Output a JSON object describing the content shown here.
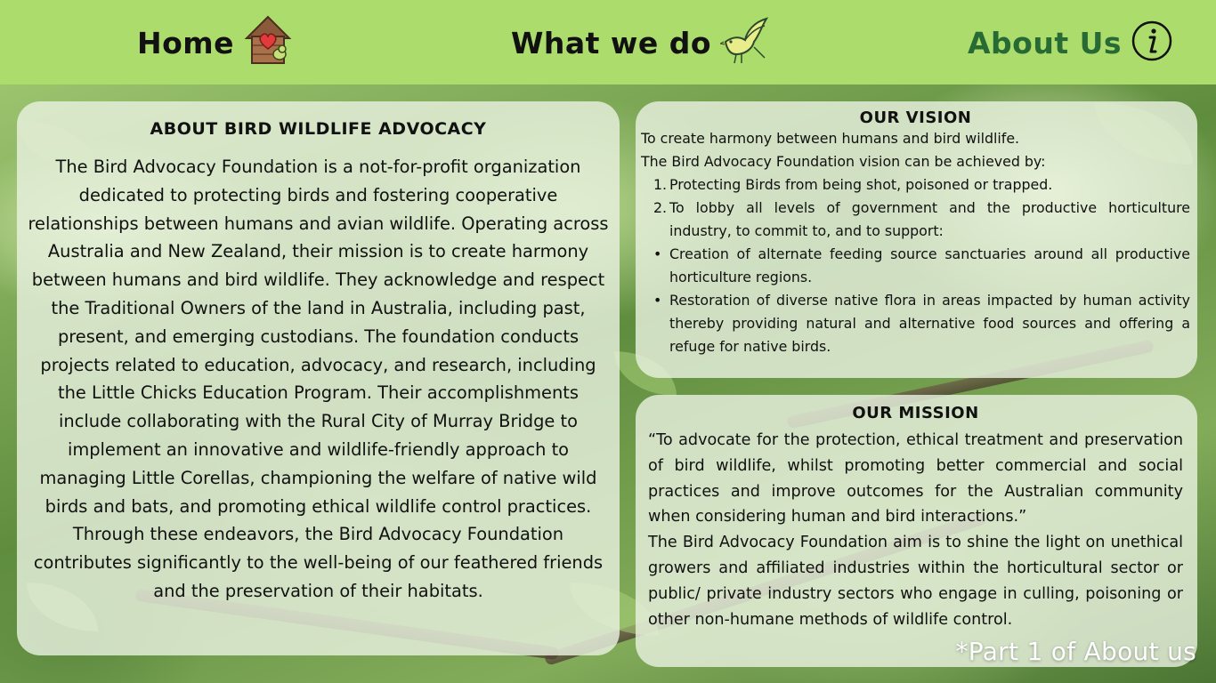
{
  "nav": {
    "home_label": "Home",
    "what_label": "What we do",
    "about_label": "About Us",
    "home_icon": "birdhouse-heart-icon",
    "what_icon": "bird-icon",
    "about_icon": "info-icon"
  },
  "about": {
    "title": "ABOUT BIRD WILDLIFE ADVOCACY",
    "body": "The Bird Advocacy Foundation is a not-for-profit organization dedicated to protecting birds and fostering cooperative relationships between humans and avian wildlife. Operating across Australia and New Zealand, their mission is to create harmony between humans and bird wildlife. They acknowledge and respect the Traditional Owners of the land in Australia, including past, present, and emerging custodians. The foundation conducts projects related to education, advocacy, and research, including the Little Chicks Education Program. Their accomplishments include collaborating with the Rural City of Murray Bridge to implement an innovative and wildlife-friendly approach to managing Little Corellas, championing the welfare of native wild birds and bats, and promoting ethical wildlife control practices. Through these endeavors, the Bird Advocacy Foundation contributes significantly to the well-being of our feathered friends and the preservation of their habitats."
  },
  "vision": {
    "title": "OUR VISION",
    "line1": "To create harmony between humans and bird wildlife.",
    "line2": "The Bird Advocacy Foundation vision can be achieved by:",
    "items": [
      {
        "marker": "1.",
        "text": "Protecting Birds from being shot, poisoned or trapped."
      },
      {
        "marker": "2.",
        "text": "To lobby all levels of government and the productive horticulture industry, to commit to, and to support:"
      },
      {
        "marker": "•",
        "text": "Creation of alternate feeding source sanctuaries around all productive horticulture regions."
      },
      {
        "marker": "•",
        "text": "Restoration of diverse native flora in areas impacted by human activity thereby providing natural and alternative food sources and offering a refuge for native birds."
      }
    ]
  },
  "mission": {
    "title": "OUR MISSION",
    "quote": "“To advocate for the protection, ethical treatment and preservation of bird wildlife, whilst promoting better commercial and social practices and improve outcomes for the Australian community when considering human and bird interactions.”",
    "aim": "The Bird Advocacy Foundation aim is to shine the light on unethical growers and affiliated industries within the horticultural sector or public/ private industry sectors who engage in culling, poisoning or other non-humane methods of wildlife control."
  },
  "footnote": "*Part 1 of About us",
  "colors": {
    "navbar": "#acdc6c",
    "about_accent": "#276a33",
    "panel": "#e8f0de"
  }
}
